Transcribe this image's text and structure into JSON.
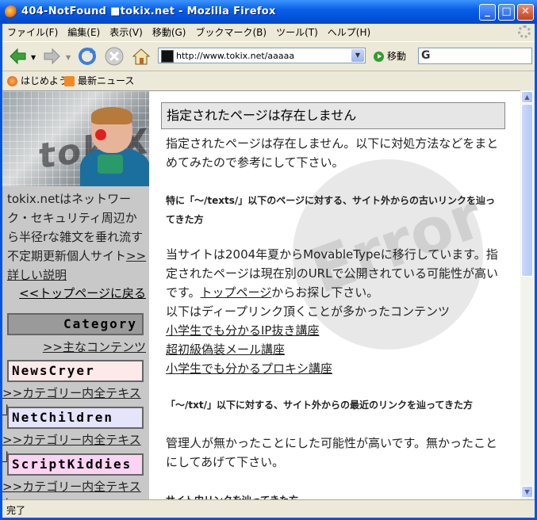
{
  "window": {
    "title": "404-NotFound ■tokix.net - Mozilla Firefox"
  },
  "menu": [
    "ファイル(F)",
    "編集(E)",
    "表示(V)",
    "移動(G)",
    "ブックマーク(B)",
    "ツール(T)",
    "ヘルプ(H)"
  ],
  "nav": {
    "url": "http://www.tokix.net/aaaaa",
    "go_label": "移動"
  },
  "bookmarks": [
    "はじめよう",
    "最新ニュース"
  ],
  "sidebar": {
    "intro": "tokix.netはネットワーク・セキュリティ周辺から半径rな雑文を垂れ流す不定期更新個人サイト",
    "detail_link": ">>詳しい説明",
    "back_link": "<<トップページに戻る",
    "categories": [
      {
        "name": "Category",
        "link": ">>主なコンテンツ",
        "color": "#9a9a9a"
      },
      {
        "name": "NewsCryer",
        "link": ">>カテゴリー内全テキスト",
        "color": "#fde8ea"
      },
      {
        "name": "NetChildren",
        "link": ">>カテゴリー内全テキスト",
        "color": "#e4e4fb"
      },
      {
        "name": "ScriptKiddies",
        "link": ">>カテゴリー内全テキスト",
        "color": "#fbd3f3"
      }
    ]
  },
  "main": {
    "heading": "指定されたページは存在しません",
    "intro": "指定されたページは存在しません。以下に対処方法などをまとめてみたので参考にして下さい。",
    "section1_title": "特に「～/texts/」以下のページに対する、サイト外からの古いリンクを辿ってきた方",
    "section1_body_a": "当サイトは2004年夏からMovableTypeに移行しています。指定されたページは現在別のURLで公開されている可能性が高いです。",
    "section1_top_link": "トップページ",
    "section1_body_b": "からお探し下さい。",
    "section1_deep": "以下はディープリンク頂くことが多かったコンテンツ",
    "links": [
      "小学生でも分かるIP抜き講座",
      "超初級偽装メール講座",
      "小学生でも分かるプロキシ講座"
    ],
    "section2_title": "「～/txt/」以下に対する、サイト外からの最近のリンクを辿ってきた方",
    "section2_body": "管理人が無かったことにした可能性が高いです。無かったことにしてあげて下さい。",
    "section3_title": "サイト内リンクを辿ってきた方",
    "watermark": "Error"
  },
  "status": "完了"
}
